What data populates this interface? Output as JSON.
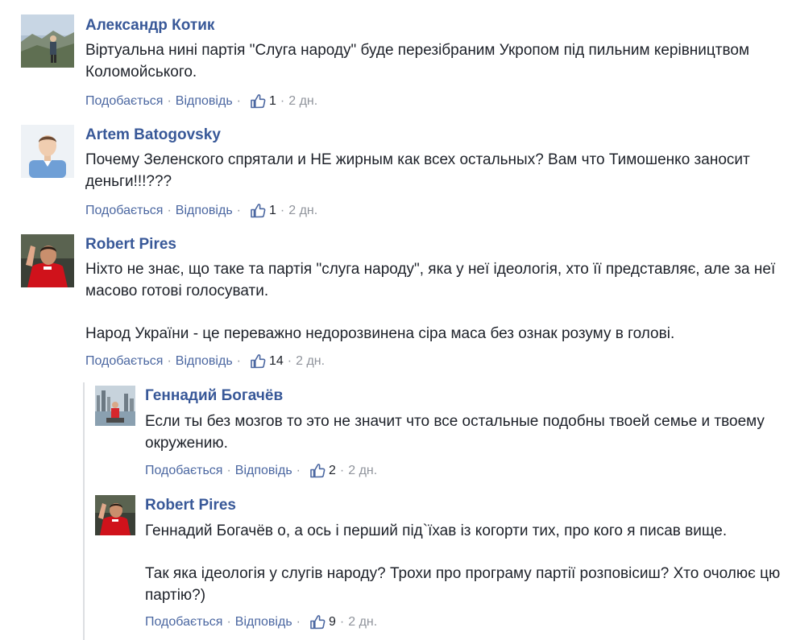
{
  "comments": [
    {
      "author": "Александр Котик",
      "text": [
        "Віртуальна нині партія \"Слуга народу\" буде перезібраним Укропом під пильним керівництвом Коломойського."
      ],
      "like_label": "Подобається",
      "reply_label": "Відповідь",
      "likes": "1",
      "time": "2 дн."
    },
    {
      "author": "Artem Batogovsky",
      "text": [
        "Почему Зеленского спрятали и НЕ жирным как всех остальных? Вам что Тимошенко заносит деньги!!!???"
      ],
      "like_label": "Подобається",
      "reply_label": "Відповідь",
      "likes": "1",
      "time": "2 дн."
    },
    {
      "author": "Robert Pires",
      "text": [
        "Ніхто не знає, що таке та партія \"слуга народу\", яка у неї ідеологія, хто її представляє, але за неї масово готові голосувати.",
        "Народ України - це переважно недорозвинена сіра маса без ознак розуму в голові."
      ],
      "like_label": "Подобається",
      "reply_label": "Відповідь",
      "likes": "14",
      "time": "2 дн.",
      "replies": [
        {
          "author": "Геннадий Богачёв",
          "text": [
            "Если ты без мозгов то это не значит что все остальные подобны твоей семье и твоему окружению."
          ],
          "like_label": "Подобається",
          "reply_label": "Відповідь",
          "likes": "2",
          "time": "2 дн."
        },
        {
          "author": "Robert Pires",
          "text": [
            "Геннадий Богачёв о, а ось і перший під`їхав із когорти тих, про кого я писав вище.",
            "Так яка ідеологія у слугів народу? Трохи про програму партії розповісиш? Хто очолює цю партію?)"
          ],
          "like_label": "Подобається",
          "reply_label": "Відповідь",
          "likes": "9",
          "time": "2 дн."
        }
      ]
    }
  ],
  "separators": {
    "dot": "·"
  },
  "colors": {
    "link": "#385898",
    "meta_link": "#4b67a1",
    "meta_text": "#90949c",
    "body_text": "#1d2129",
    "thread_line": "#dddfe2"
  },
  "icons": {
    "like": "thumbs-up-icon"
  }
}
